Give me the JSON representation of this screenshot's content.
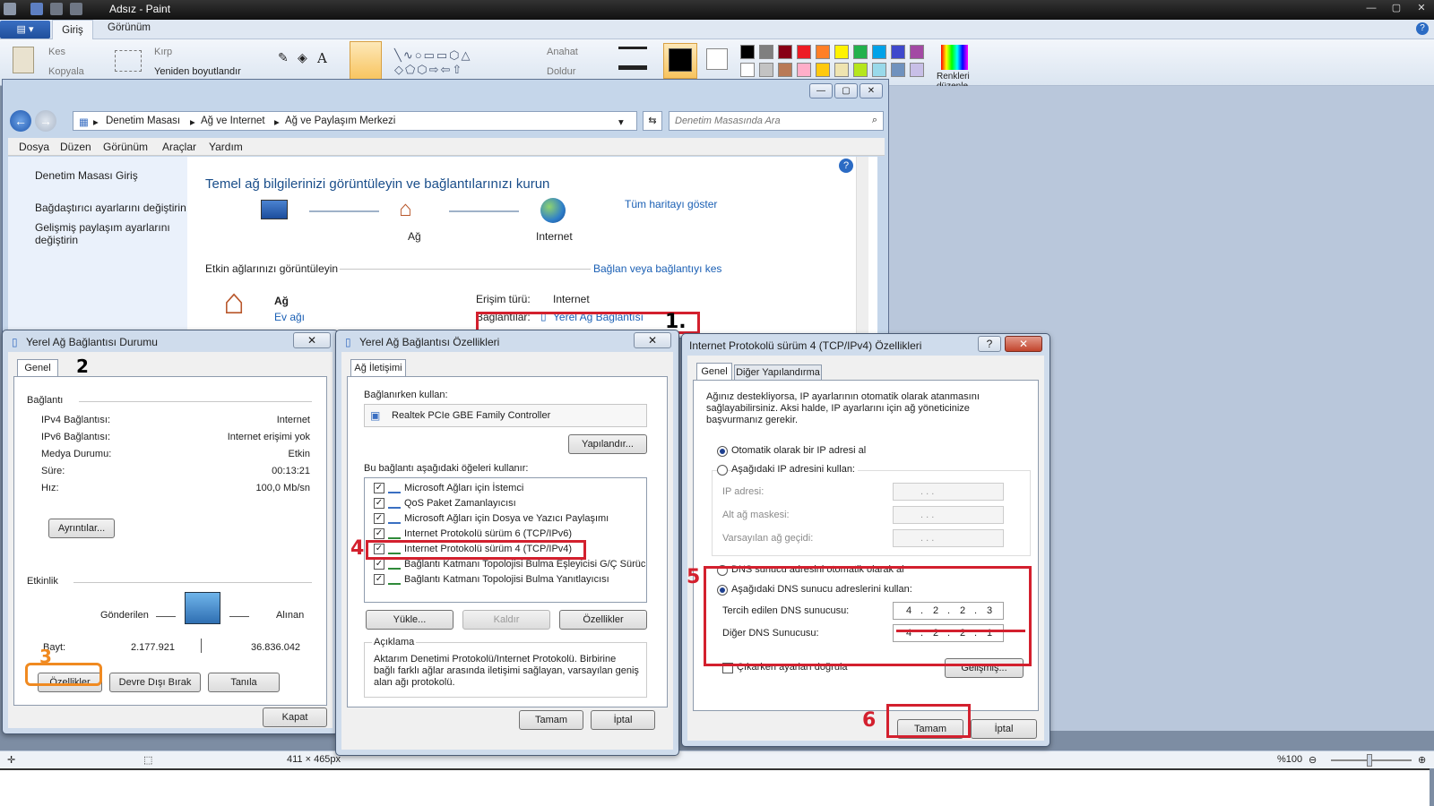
{
  "paint": {
    "title": "Adsız - Paint",
    "tabs": [
      "Giriş",
      "Görünüm"
    ],
    "clipboard": {
      "cut": "Kes",
      "copy": "Kopyala"
    },
    "image": {
      "crop": "Kırp",
      "resize": "Yeniden boyutlandır"
    },
    "shapes": {
      "outline": "Anahat",
      "fill": "Doldur"
    },
    "edit_colors": "Renkleri düzenle",
    "status": {
      "size": "411 × 465px",
      "zoom": "%100"
    },
    "palette_top": [
      "#000000",
      "#7f7f7f",
      "#880015",
      "#ed1c24",
      "#ff7f27",
      "#fff200",
      "#22b14c",
      "#00a2e8",
      "#3f48cc",
      "#a349a4"
    ],
    "palette_bottom": [
      "#ffffff",
      "#c3c3c3",
      "#b97a57",
      "#ffaec9",
      "#ffc90e",
      "#efe4b0",
      "#b5e61d",
      "#99d9ea",
      "#7092be",
      "#c8bfe7"
    ]
  },
  "control_panel": {
    "breadcrumb": [
      "Denetim Masası",
      "Ağ ve Internet",
      "Ağ ve Paylaşım Merkezi"
    ],
    "search_placeholder": "Denetim Masasında Ara",
    "menu": [
      "Dosya",
      "Düzen",
      "Görünüm",
      "Araçlar",
      "Yardım"
    ],
    "sidebar": [
      "Denetim Masası Giriş",
      "Bağdaştırıcı ayarlarını değiştirin",
      "Gelişmiş paylaşım ayarlarını değiştirin"
    ],
    "heading": "Temel ağ bilgilerinizi görüntüleyin ve bağlantılarınızı kurun",
    "map_link": "Tüm haritayı göster",
    "map_nodes": [
      "Ağ",
      "Internet"
    ],
    "active_networks": "Etkin ağlarınızı görüntüleyin",
    "connect_link": "Bağlan veya bağlantıyı kes",
    "network_name": "Ağ",
    "network_type": "Ev ağı",
    "access_type_label": "Erişim türü:",
    "access_type_value": "Internet",
    "connections_label": "Bağlantılar:",
    "connections_value": "Yerel Ağ Bağlantısı"
  },
  "status_dialog": {
    "title": "Yerel Ağ Bağlantısı Durumu",
    "tab": "Genel",
    "connection_header": "Bağlantı",
    "rows": [
      {
        "label": "IPv4 Bağlantısı:",
        "value": "Internet"
      },
      {
        "label": "IPv6 Bağlantısı:",
        "value": "Internet erişimi yok"
      },
      {
        "label": "Medya Durumu:",
        "value": "Etkin"
      },
      {
        "label": "Süre:",
        "value": "00:13:21"
      },
      {
        "label": "Hız:",
        "value": "100,0 Mb/sn"
      }
    ],
    "details_button": "Ayrıntılar...",
    "activity_header": "Etkinlik",
    "sent": "Gönderilen",
    "received": "Alınan",
    "bytes_label": "Bayt:",
    "bytes_sent": "2.177.921",
    "bytes_received": "36.836.042",
    "buttons": [
      "Özellikler",
      "Devre Dışı Bırak",
      "Tanıla"
    ],
    "close": "Kapat"
  },
  "props_dialog": {
    "title": "Yerel Ağ Bağlantısı Özellikleri",
    "tab": "Ağ İletişimi",
    "connect_using": "Bağlanırken kullan:",
    "adapter": "Realtek PCIe GBE Family Controller",
    "configure": "Yapılandır...",
    "items_label": "Bu bağlantı aşağıdaki öğeleri kullanır:",
    "items": [
      "Microsoft Ağları için İstemci",
      "QoS Paket Zamanlayıcısı",
      "Microsoft Ağları için Dosya ve Yazıcı Paylaşımı",
      "Internet Protokolü sürüm 6 (TCP/IPv6)",
      "Internet Protokolü sürüm 4 (TCP/IPv4)",
      "Bağlantı Katmanı Topolojisi Bulma Eşleyicisi G/Ç Sürücü...",
      "Bağlantı Katmanı Topolojisi Bulma Yanıtlayıcısı"
    ],
    "buttons": [
      "Yükle...",
      "Kaldır",
      "Özellikler"
    ],
    "description_label": "Açıklama",
    "description": "Aktarım Denetimi Protokolü/Internet Protokolü. Birbirine bağlı farklı ağlar arasında iletişimi sağlayan, varsayılan geniş alan ağı protokolü.",
    "ok": "Tamam",
    "cancel": "İptal"
  },
  "ipv4_dialog": {
    "title": "Internet Protokolü sürüm 4 (TCP/IPv4) Özellikleri",
    "tabs": [
      "Genel",
      "Diğer Yapılandırma"
    ],
    "intro": "Ağınız destekliyorsa, IP ayarlarının otomatik olarak atanmasını sağlayabilirsiniz. Aksi halde, IP ayarlarını için ağ yöneticinize başvurmanız gerekir.",
    "auto_ip": "Otomatik olarak bir IP adresi al",
    "manual_ip": "Aşağıdaki IP adresini kullan:",
    "ip_address": "IP adresi:",
    "subnet": "Alt ağ maskesi:",
    "gateway": "Varsayılan ağ geçidi:",
    "empty_ip": ".       .       .",
    "auto_dns": "DNS sunucu adresini otomatik olarak al",
    "manual_dns": "Aşağıdaki DNS sunucu adreslerini kullan:",
    "preferred_dns_label": "Tercih edilen DNS sunucusu:",
    "preferred_dns": [
      "4",
      "2",
      "2",
      "3"
    ],
    "alternate_dns_label": "Diğer DNS Sunucusu:",
    "alternate_dns": [
      "4",
      "2",
      "2",
      "1"
    ],
    "validate": "Çıkarken ayarları doğrula",
    "advanced": "Gelişmiş...",
    "ok": "Tamam",
    "cancel": "İptal"
  },
  "annotations": {
    "step1": "1.",
    "step2": "2",
    "step3": "3",
    "step4": "4",
    "step5": "5",
    "step6": "6",
    "red": "#d3202e",
    "orange": "#f08a21"
  }
}
